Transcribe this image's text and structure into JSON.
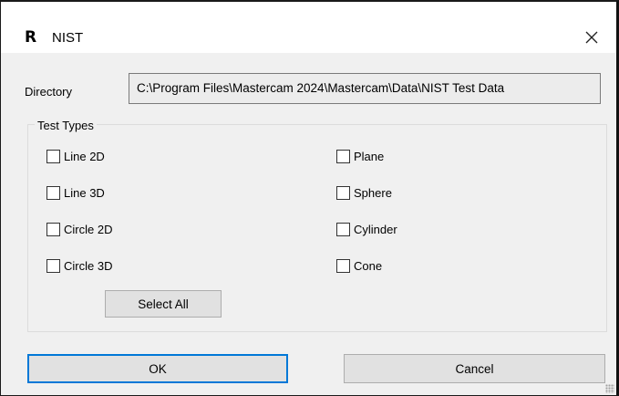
{
  "window": {
    "icon": "R",
    "title": "NIST",
    "close_glyph": "✕"
  },
  "directory": {
    "label": "Directory",
    "value": "C:\\Program Files\\Mastercam 2024\\Mastercam\\Data\\NIST Test Data"
  },
  "test_types": {
    "group_label": "Test Types",
    "left": [
      {
        "label": "Line 2D",
        "checked": false
      },
      {
        "label": "Line 3D",
        "checked": false
      },
      {
        "label": "Circle 2D",
        "checked": false
      },
      {
        "label": "Circle 3D",
        "checked": false
      }
    ],
    "right": [
      {
        "label": "Plane",
        "checked": false
      },
      {
        "label": "Sphere",
        "checked": false
      },
      {
        "label": "Cylinder",
        "checked": false
      },
      {
        "label": "Cone",
        "checked": false
      }
    ],
    "select_all_label": "Select All"
  },
  "buttons": {
    "ok_label": "OK",
    "cancel_label": "Cancel"
  }
}
